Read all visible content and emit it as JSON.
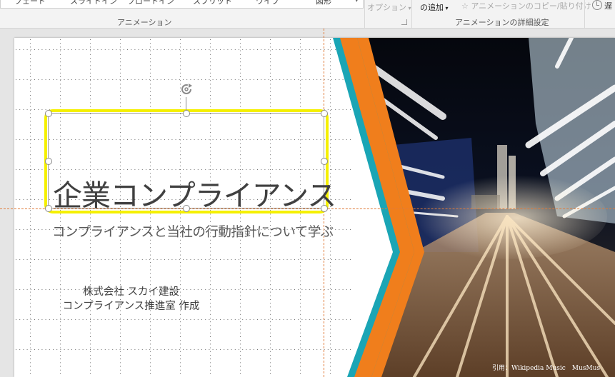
{
  "ribbon": {
    "animation_gallery_items": [
      "フェード",
      "スライドイン",
      "フロートイン",
      "スプリット",
      "ワイプ",
      "図形"
    ],
    "effect_options_label": "オプション",
    "add_animation_label": "の追加",
    "animation_painter_label": "アニメーションのコピー/貼り付け",
    "timing_partial_label": "遅",
    "group_animation_label": "アニメーション",
    "group_advanced_label": "アニメーションの詳細設定"
  },
  "slide": {
    "title": "企業コンプライアンス",
    "subtitle": "コンプライアンスと当社の行動指針について学ぶ",
    "company_line1": "株式会社 スカイ建設",
    "company_line2": "コンプライアンス推進室 作成",
    "credit": "引用：Wikipedia Music　MusMus"
  },
  "colors": {
    "selection_highlight": "#f5f000",
    "guide": "#e07b39",
    "teal_band": "#1aa5b5",
    "orange_band": "#f07e1c",
    "ribbon_bg": "#f3f3f3"
  },
  "icons": {
    "rotate_handle": "rotate-icon",
    "animation_painter": "star-brush-icon",
    "timing": "clock-icon",
    "dropdown": "chevron-down-icon"
  }
}
